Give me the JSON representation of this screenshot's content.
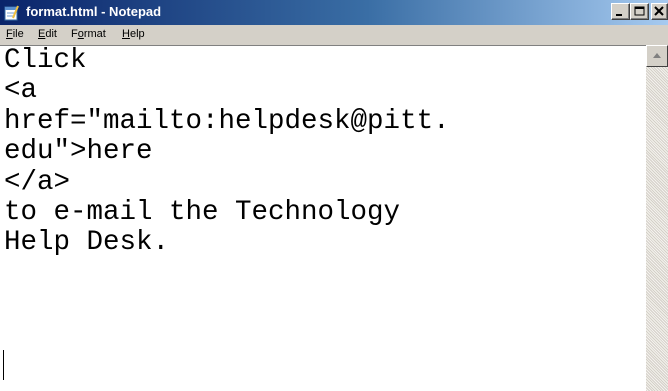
{
  "window": {
    "title": "format.html - Notepad",
    "icon": "notepad-icon",
    "buttons": [
      "minimize-icon",
      "maximize-icon",
      "close-icon"
    ]
  },
  "menu": {
    "items": [
      {
        "label": "File",
        "accel": "F",
        "rest": "ile"
      },
      {
        "label": "Edit",
        "accel": "E",
        "rest": "dit"
      },
      {
        "label": "Format",
        "pre": "F",
        "accel": "o",
        "rest": "rmat"
      },
      {
        "label": "Help",
        "accel": "H",
        "rest": "elp"
      }
    ]
  },
  "document": {
    "content": "Click\n<a\nhref=\"mailto:helpdesk@pitt.\nedu\">here\n</a>\nto e-mail the Technology\nHelp Desk."
  },
  "colors": {
    "titlebar_start": "#0a246a",
    "titlebar_end": "#a6caf0",
    "chrome": "#d4d0c8"
  }
}
